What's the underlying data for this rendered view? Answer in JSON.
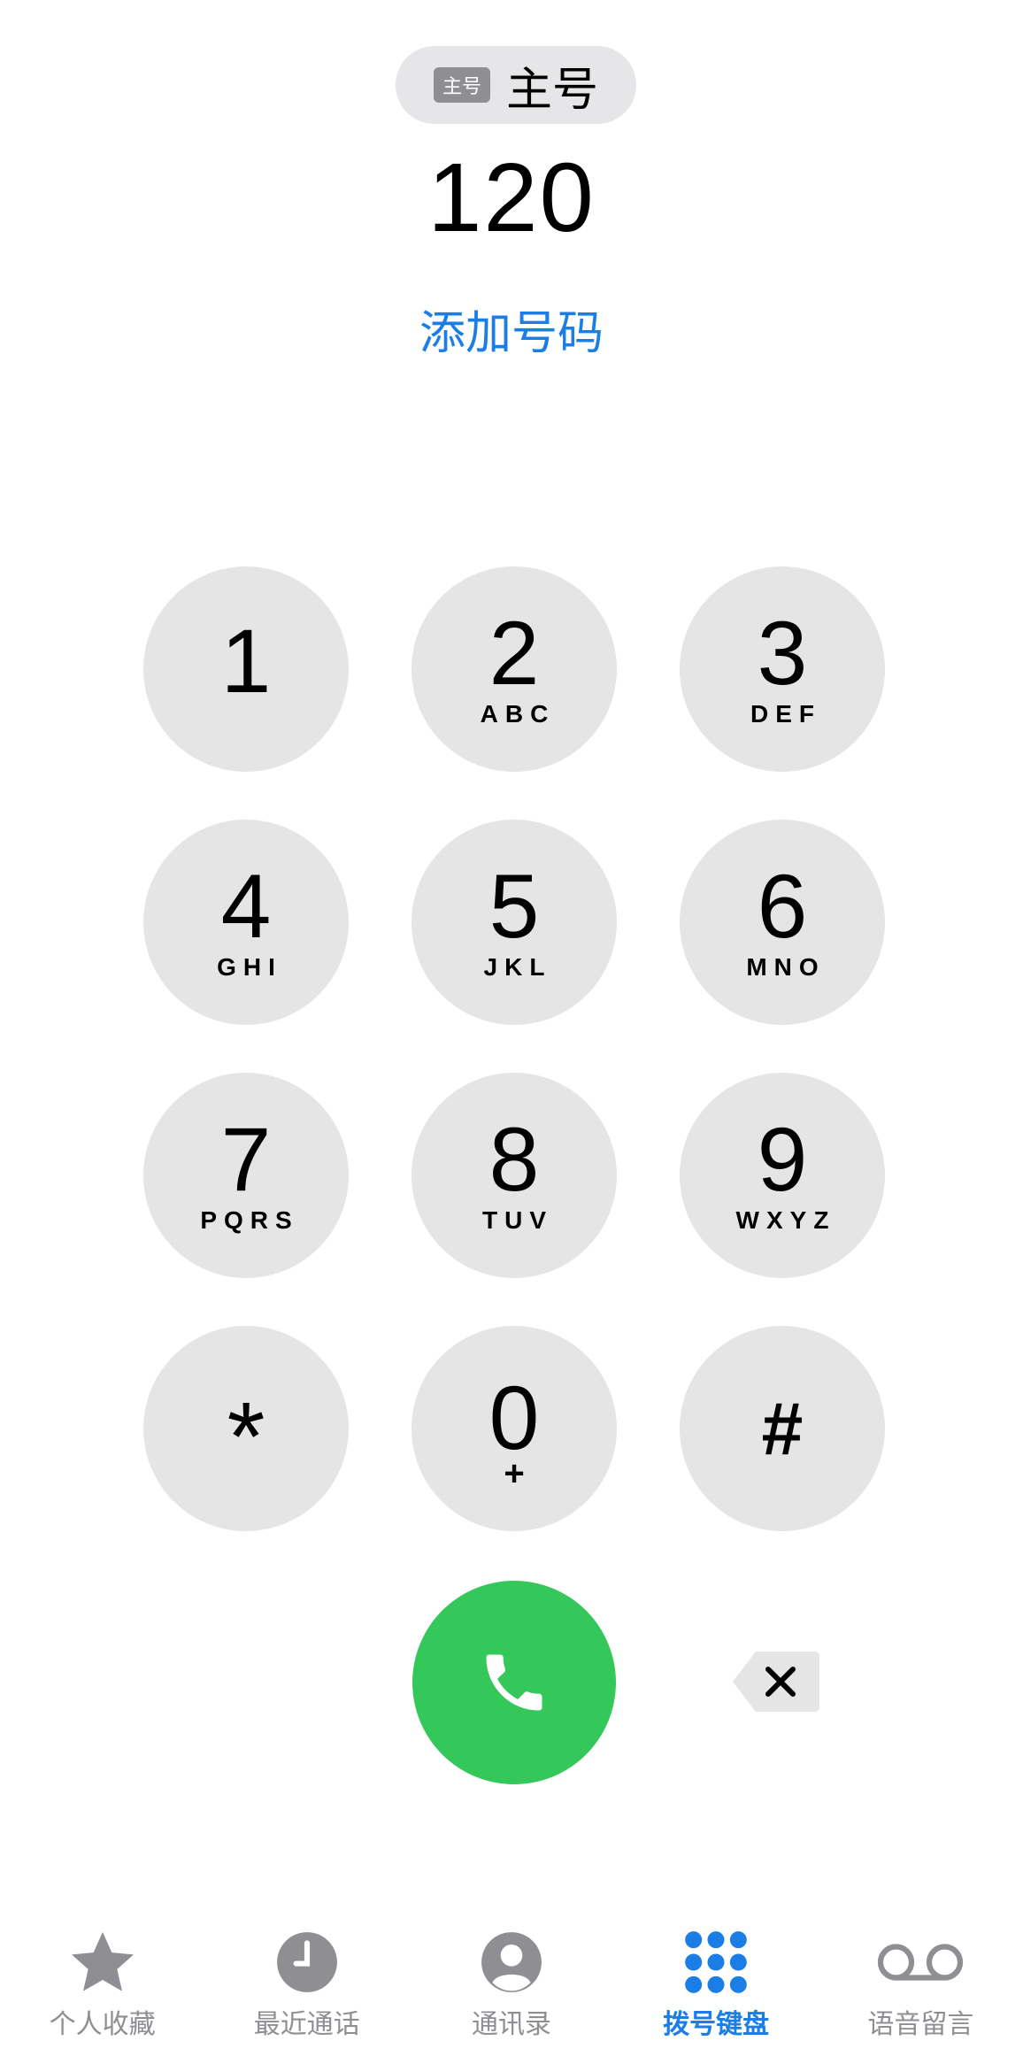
{
  "line": {
    "badge": "主号",
    "label": "主号"
  },
  "display": {
    "number": "120",
    "add_number": "添加号码"
  },
  "keypad": [
    {
      "digit": "1",
      "letters": ""
    },
    {
      "digit": "2",
      "letters": "ABC"
    },
    {
      "digit": "3",
      "letters": "DEF"
    },
    {
      "digit": "4",
      "letters": "GHI"
    },
    {
      "digit": "5",
      "letters": "JKL"
    },
    {
      "digit": "6",
      "letters": "MNO"
    },
    {
      "digit": "7",
      "letters": "PQRS"
    },
    {
      "digit": "8",
      "letters": "TUV"
    },
    {
      "digit": "9",
      "letters": "WXYZ"
    },
    {
      "digit": "*",
      "letters": ""
    },
    {
      "digit": "0",
      "letters": "+"
    },
    {
      "digit": "#",
      "letters": ""
    }
  ],
  "tabs": [
    {
      "label": "个人收藏",
      "icon": "star-icon",
      "active": false
    },
    {
      "label": "最近通话",
      "icon": "clock-icon",
      "active": false
    },
    {
      "label": "通讯录",
      "icon": "contact-icon",
      "active": false
    },
    {
      "label": "拨号键盘",
      "icon": "keypad-icon",
      "active": true
    },
    {
      "label": "语音留言",
      "icon": "voicemail-icon",
      "active": false
    }
  ],
  "colors": {
    "accent": "#1a7ee6",
    "call": "#34c759",
    "key_bg": "#e5e5e6",
    "inactive": "#8e8e93"
  }
}
